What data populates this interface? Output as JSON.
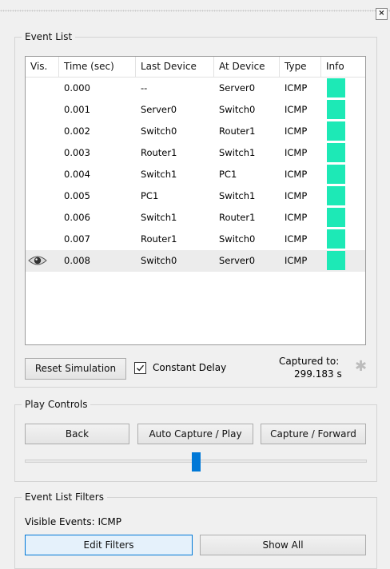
{
  "window": {
    "close_label": "×"
  },
  "event_list": {
    "title": "Event List",
    "columns": [
      "Vis.",
      "Time (sec)",
      "Last Device",
      "At Device",
      "Type",
      "Info"
    ],
    "rows": [
      {
        "visible": false,
        "time": "0.000",
        "last_device": "--",
        "at_device": "Server0",
        "type": "ICMP",
        "info_color": "#1de9b6"
      },
      {
        "visible": false,
        "time": "0.001",
        "last_device": "Server0",
        "at_device": "Switch0",
        "type": "ICMP",
        "info_color": "#1de9b6"
      },
      {
        "visible": false,
        "time": "0.002",
        "last_device": "Switch0",
        "at_device": "Router1",
        "type": "ICMP",
        "info_color": "#1de9b6"
      },
      {
        "visible": false,
        "time": "0.003",
        "last_device": "Router1",
        "at_device": "Switch1",
        "type": "ICMP",
        "info_color": "#1de9b6"
      },
      {
        "visible": false,
        "time": "0.004",
        "last_device": "Switch1",
        "at_device": "PC1",
        "type": "ICMP",
        "info_color": "#1de9b6"
      },
      {
        "visible": false,
        "time": "0.005",
        "last_device": "PC1",
        "at_device": "Switch1",
        "type": "ICMP",
        "info_color": "#1de9b6"
      },
      {
        "visible": false,
        "time": "0.006",
        "last_device": "Switch1",
        "at_device": "Router1",
        "type": "ICMP",
        "info_color": "#1de9b6"
      },
      {
        "visible": false,
        "time": "0.007",
        "last_device": "Router1",
        "at_device": "Switch0",
        "type": "ICMP",
        "info_color": "#1de9b6"
      },
      {
        "visible": true,
        "time": "0.008",
        "last_device": "Switch0",
        "at_device": "Server0",
        "type": "ICMP",
        "info_color": "#1de9b6"
      }
    ],
    "reset_label": "Reset Simulation",
    "constant_delay_label": "Constant Delay",
    "constant_delay_checked": true,
    "captured_label": "Captured to:",
    "captured_value": "299.183 s",
    "captured_icon": "asterisk-icon"
  },
  "play_controls": {
    "title": "Play Controls",
    "back_label": "Back",
    "auto_label": "Auto Capture / Play",
    "forward_label": "Capture / Forward",
    "speed_fraction": 0.5
  },
  "filters": {
    "title": "Event List Filters",
    "visible_events_label": "Visible Events: ICMP",
    "edit_label": "Edit Filters",
    "show_all_label": "Show All"
  },
  "colors": {
    "accent": "#0078d7",
    "info": "#1de9b6"
  }
}
